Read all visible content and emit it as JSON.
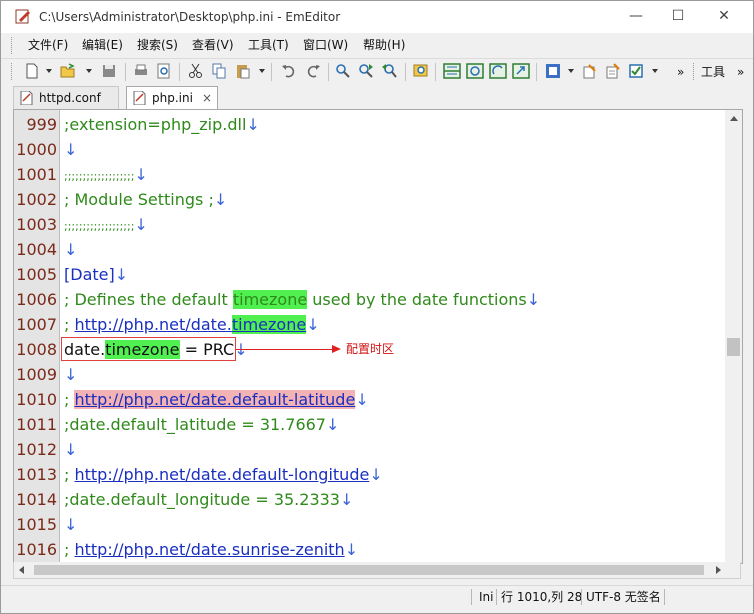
{
  "window": {
    "title": "C:\\Users\\Administrator\\Desktop\\php.ini - EmEditor",
    "minimize": "—",
    "maximize": "☐",
    "close": "✕"
  },
  "menu": [
    "文件(F)",
    "编辑(E)",
    "搜索(S)",
    "查看(V)",
    "工具(T)",
    "窗口(W)",
    "帮助(H)"
  ],
  "toolbar": {
    "overflow": "»",
    "overflow2": "»",
    "tools_label": "工具"
  },
  "tabs": [
    {
      "label": "httpd.conf",
      "active": false
    },
    {
      "label": "php.ini",
      "active": true,
      "close": "×"
    }
  ],
  "editor": {
    "eol_mark": "↓",
    "lines": [
      {
        "num": "999",
        "text": ";extension=php_zip.dll"
      },
      {
        "num": "1000",
        "text": ""
      },
      {
        "num": "1001",
        "text": ";;;;;;;;;;;;;;;;;;;"
      },
      {
        "num": "1002",
        "text": "; Module Settings ;"
      },
      {
        "num": "1003",
        "text": ";;;;;;;;;;;;;;;;;;;"
      },
      {
        "num": "1004",
        "text": ""
      },
      {
        "num": "1005",
        "text": "[Date]"
      },
      {
        "num": "1006",
        "pre": "; Defines the default ",
        "hl": "timezone",
        "post": " used by the date functions"
      },
      {
        "num": "1007",
        "pre": "; ",
        "url": "http://php.net/date.",
        "hl": "timezone"
      },
      {
        "num": "1008",
        "pre": "date.",
        "hl": "timezone",
        "post": " = PRC"
      },
      {
        "num": "1009",
        "text": ""
      },
      {
        "num": "1010",
        "pre": "; ",
        "url": "http://php.net/date.default-latitude"
      },
      {
        "num": "1011",
        "text": ";date.default_latitude = 31.7667"
      },
      {
        "num": "1012",
        "text": ""
      },
      {
        "num": "1013",
        "pre": "; ",
        "url": "http://php.net/date.default-longitude"
      },
      {
        "num": "1014",
        "text": ";date.default_longitude = 35.2333"
      },
      {
        "num": "1015",
        "text": ""
      },
      {
        "num": "1016",
        "pre": "; ",
        "url": "http://php.net/date.sunrise-zenith"
      }
    ],
    "annotation": "配置时区"
  },
  "status": {
    "mode": "Ini",
    "position": "行 1010,列 28",
    "encoding": "UTF-8 无签名"
  }
}
